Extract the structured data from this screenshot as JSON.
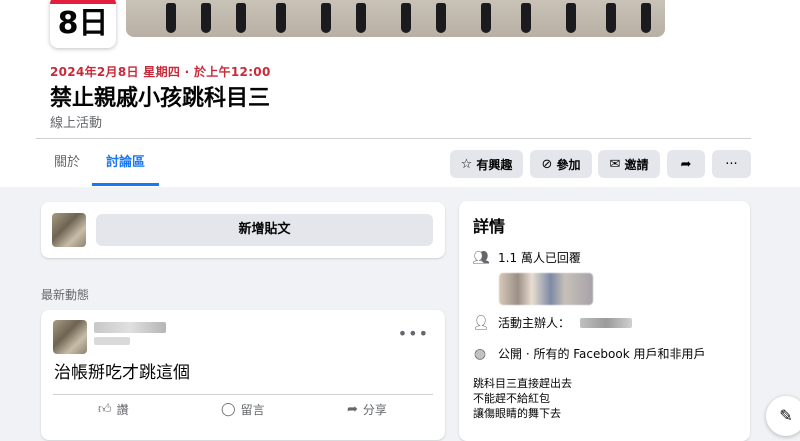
{
  "event": {
    "day": "8日",
    "datetime": "2024年2月8日 星期四 · 於上午12:00",
    "title": "禁止親戚小孩跳科目三",
    "type": "線上活動"
  },
  "tabs": [
    {
      "label": "關於"
    },
    {
      "label": "討論區",
      "active": true
    }
  ],
  "actions": {
    "interested": "有興趣",
    "join": "參加",
    "invite": "邀請"
  },
  "icons": {
    "interested": "star-icon",
    "join": "check-circle-icon",
    "invite": "envelope-icon",
    "share": "share-arrow-icon",
    "more": "more-dots-icon"
  },
  "composer": {
    "button_label": "新增貼文"
  },
  "feed": {
    "section_label": "最新動態"
  },
  "post": {
    "text": "治帳掰吃才跳這個",
    "like": "讚",
    "comment": "留言",
    "share": "分享"
  },
  "details": {
    "title": "詳情",
    "responses": "1.1 萬人已回覆",
    "host_label": "活動主辦人：",
    "privacy": "公開 · 所有的 Facebook 用戶和非用戶",
    "description_lines": [
      "跳科目三直接趕出去",
      "不能趕不給紅包",
      "讓傷眼睛的舞下去"
    ]
  },
  "colors": {
    "accent": "#1877f2",
    "date_red": "#c92a3a",
    "background": "#f0f2f5"
  }
}
